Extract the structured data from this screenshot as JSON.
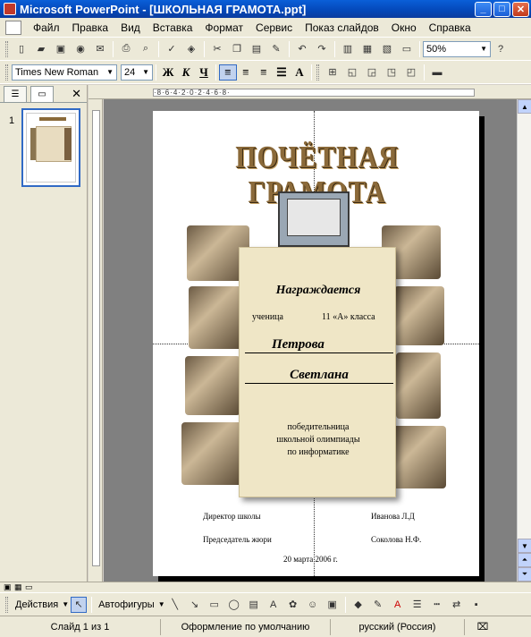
{
  "window": {
    "title": "Microsoft PowerPoint - [ШКОЛЬНАЯ ГРАМОТА.ppt]"
  },
  "menu": [
    "Файл",
    "Правка",
    "Вид",
    "Вставка",
    "Формат",
    "Сервис",
    "Показ слайдов",
    "Окно",
    "Справка"
  ],
  "toolbar": {
    "zoom": "50%"
  },
  "format": {
    "font": "Times New Roman",
    "size": "24",
    "bold": "Ж",
    "italic": "К",
    "underline": "Ч"
  },
  "panel": {
    "slide_number": "1"
  },
  "slide": {
    "heading": "ПОЧЁТНАЯ ГРАМОТА",
    "awarded": "Награждается",
    "student_label": "ученица",
    "class_text": "11 «А» класса",
    "surname": "Петрова",
    "first_name": "Светлана",
    "reason_line1": "победительница",
    "reason_line2": "школьной олимпиады",
    "reason_line3": "по информатике",
    "director_label": "Директор школы",
    "director_name": "Иванова Л.Д",
    "jury_label": "Председатель жюри",
    "jury_name": "Соколова Н.Ф.",
    "date": "20 марта 2006 г."
  },
  "drawing": {
    "actions": "Действия",
    "autoshapes": "Автофигуры"
  },
  "status": {
    "slide": "Слайд 1 из 1",
    "design": "Оформление по умолчанию",
    "language": "русский (Россия)"
  },
  "ruler_text": "·8·6·4·2·0·2·4·6·8·"
}
